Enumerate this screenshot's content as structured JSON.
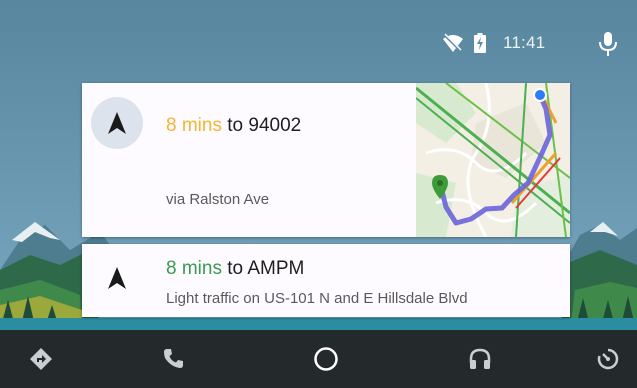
{
  "status_bar": {
    "time": "11:41",
    "icons": [
      "wifi-off-icon",
      "battery-charging-icon"
    ],
    "mic_icon": "microphone-icon"
  },
  "cards": [
    {
      "icon": "navigation-arrow-icon",
      "eta": "8 mins",
      "eta_color": "#f2b632",
      "joiner": " to ",
      "destination": "94002",
      "subtitle": "via Ralston Ave",
      "map_icon": "map-thumbnail"
    },
    {
      "icon": "navigation-arrow-icon",
      "eta": "8 mins",
      "eta_color": "#3a9a54",
      "joiner": " to ",
      "destination": "AMPM",
      "subtitle": "Light traffic on US-101 N and E Hillsdale Blvd"
    }
  ],
  "bottom_nav": {
    "items": [
      "navigation-icon",
      "phone-icon",
      "home-icon",
      "headphones-icon",
      "exit-icon"
    ]
  },
  "colors": {
    "sky": "#5f8caa",
    "card": "#fdfbff",
    "navbar": "#24292c"
  }
}
